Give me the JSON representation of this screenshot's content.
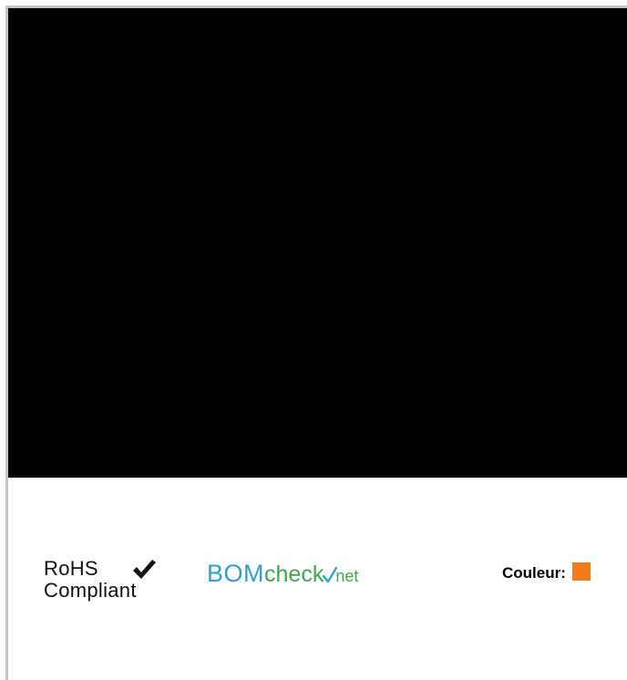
{
  "image": {
    "background": "#000000"
  },
  "rohs": {
    "line1": "RoHS",
    "line2": "Compliant",
    "icon": "checkmark-icon"
  },
  "bomcheck": {
    "part1": "BOM",
    "part2": "check",
    "part3": "net",
    "colors": {
      "bom": "#2e9fd6",
      "check": "#3aa94a"
    }
  },
  "color": {
    "label": "Couleur:",
    "swatch": "#f07d1c"
  }
}
